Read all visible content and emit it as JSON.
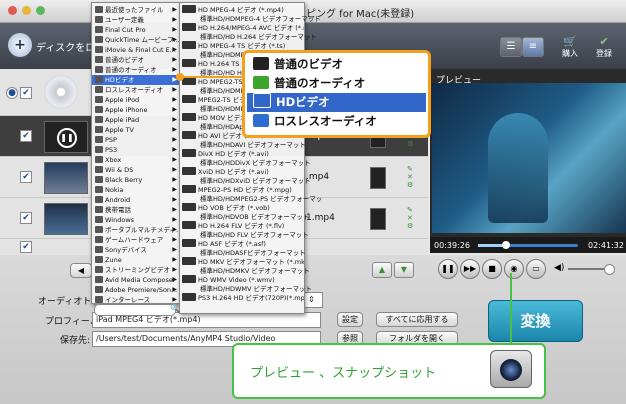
{
  "window": {
    "title": "ピング for Mac(未登録)"
  },
  "toolbar": {
    "add_label": "ディスクをロ",
    "buy_label": "購入",
    "register_label": "登録"
  },
  "rows": [
    {
      "file": "",
      "checked": true
    },
    {
      "file": ".mp4",
      "checked": true
    },
    {
      "file": ".mp4",
      "checked": true
    },
    {
      "file": "1.mp4",
      "checked": true
    },
    {
      "file": "",
      "checked": true
    }
  ],
  "menu1": {
    "items": [
      "最近使ったファイル",
      "ユーザー定義",
      "Final Cut Pro",
      "QuickTime ムービーフ...",
      "iMovie & Final Cut E...",
      "普通のビデオ",
      "普通のオーディオ",
      "HDビデオ",
      "ロスレスオーディオ",
      "Apple iPod",
      "Apple iPhone",
      "Apple iPad",
      "Apple TV",
      "PSP",
      "PS3",
      "Xbox",
      "Wii & DS",
      "Black Berry",
      "Nokia",
      "Android",
      "携帯電話",
      "Windows",
      "ポータブルマルチメディ...",
      "ゲームハードウェア",
      "Sonyデバイス",
      "Zune",
      "ストリーミングビデオ",
      "Avid Media Composer",
      "Adobe Premiere/Son...",
      "インターレース"
    ],
    "selected_index": 7
  },
  "menu2": {
    "items": [
      {
        "name": "HD MPEG-4 ビデオ (*.mp4)",
        "sub": "標準HD/HDMPEG-4 ビデオフォーマット"
      },
      {
        "name": "HD H.264/MPEG-4 AVC ビデオ (*.mp4)",
        "sub": "標準HD/HD H.264 ビデオフォーマット"
      },
      {
        "name": "HD MPEG-4 TS ビデオ (*.ts)",
        "sub": "標準HD/HDMPEG-4 ビデオフォーマット"
      },
      {
        "name": "HD H.264 TS ビデオ (*.ts)",
        "sub": "標準HD/HD H.264 ビデオフォーマット"
      },
      {
        "name": "HD MPEG2-TS ビデオ (*.ts)",
        "sub": "標準HD/HDMPEG2-TS ビデオフォーマット"
      },
      {
        "name": "MPEG2-TS ビデオ (*.ts)",
        "sub": "標準HD/HDMPEG2-TS ビデオフォーマット"
      },
      {
        "name": "HD MOV ビデオ (*.mov)",
        "sub": "標準HD/HDApple QuickTime ビデオフォーマット"
      },
      {
        "name": "HD AVI ビデオ (*.avi)",
        "sub": "標準HD/HDAVI ビデオフォーマット"
      },
      {
        "name": "DivX HD ビデオ (*.avi)",
        "sub": "標準HD/HDDivX ビデオフォーマット"
      },
      {
        "name": "XviD HD ビデオ (*.avi)",
        "sub": "標準HD/HDXviD ビデオフォーマット"
      },
      {
        "name": "MPEG2-PS HD ビデオ (*.mpg)",
        "sub": "標準HD/HDMPEG2-PS ビデオフォーマット"
      },
      {
        "name": "HD VOB ビデオ (*.vob)",
        "sub": "標準HD/HDVOB ビデオフォーマット"
      },
      {
        "name": "HD H.264 FLV ビデオ (*.flv)",
        "sub": "標準HD/HD FLV ビデオフォーマット"
      },
      {
        "name": "HD ASF ビデオ (*.asf)",
        "sub": "標準HD/HDASFビデオフォーマット"
      },
      {
        "name": "HD MKV ビデオフォーマット (*.mkv)",
        "sub": "標準HD/HDMKV ビデオフォーマット"
      },
      {
        "name": "HD WMV Video (*.wmv)",
        "sub": "標準HD/HDWMV ビデオフォーマット"
      },
      {
        "name": "PS3 H.264 HD ビデオ(720P)(*.mp4)",
        "sub": ""
      }
    ]
  },
  "popup": {
    "items": [
      "普通のビデオ",
      "普通のオーディオ",
      "HDビデオ",
      "ロスレスオーディオ"
    ],
    "selected_index": 2
  },
  "preview": {
    "label": "プレビュー",
    "current_time": "00:39:26",
    "total_time": "02:41:32",
    "progress": 0.28
  },
  "settings": {
    "audio_track_label": "オーディオトラック:",
    "profile_label": "プロフィール:",
    "profile_value": "iPad MPEG4 ビデオ(*.mp4)",
    "save_label": "保存先:",
    "save_path": "/Users/test/Documents/AnyMP4 Studio/Video",
    "settings_btn": "設定",
    "apply_all_btn": "すべてに応用する",
    "browse_btn": "参照",
    "open_folder_btn": "フォルダを開く",
    "convert_btn": "変換"
  },
  "callout": {
    "text": "プレビュー 、スナップショット"
  },
  "colors": {
    "accent": "#3266c8",
    "highlight_border": "#f2a01d",
    "callout_green": "#47c247",
    "convert": "#1b86ac"
  }
}
